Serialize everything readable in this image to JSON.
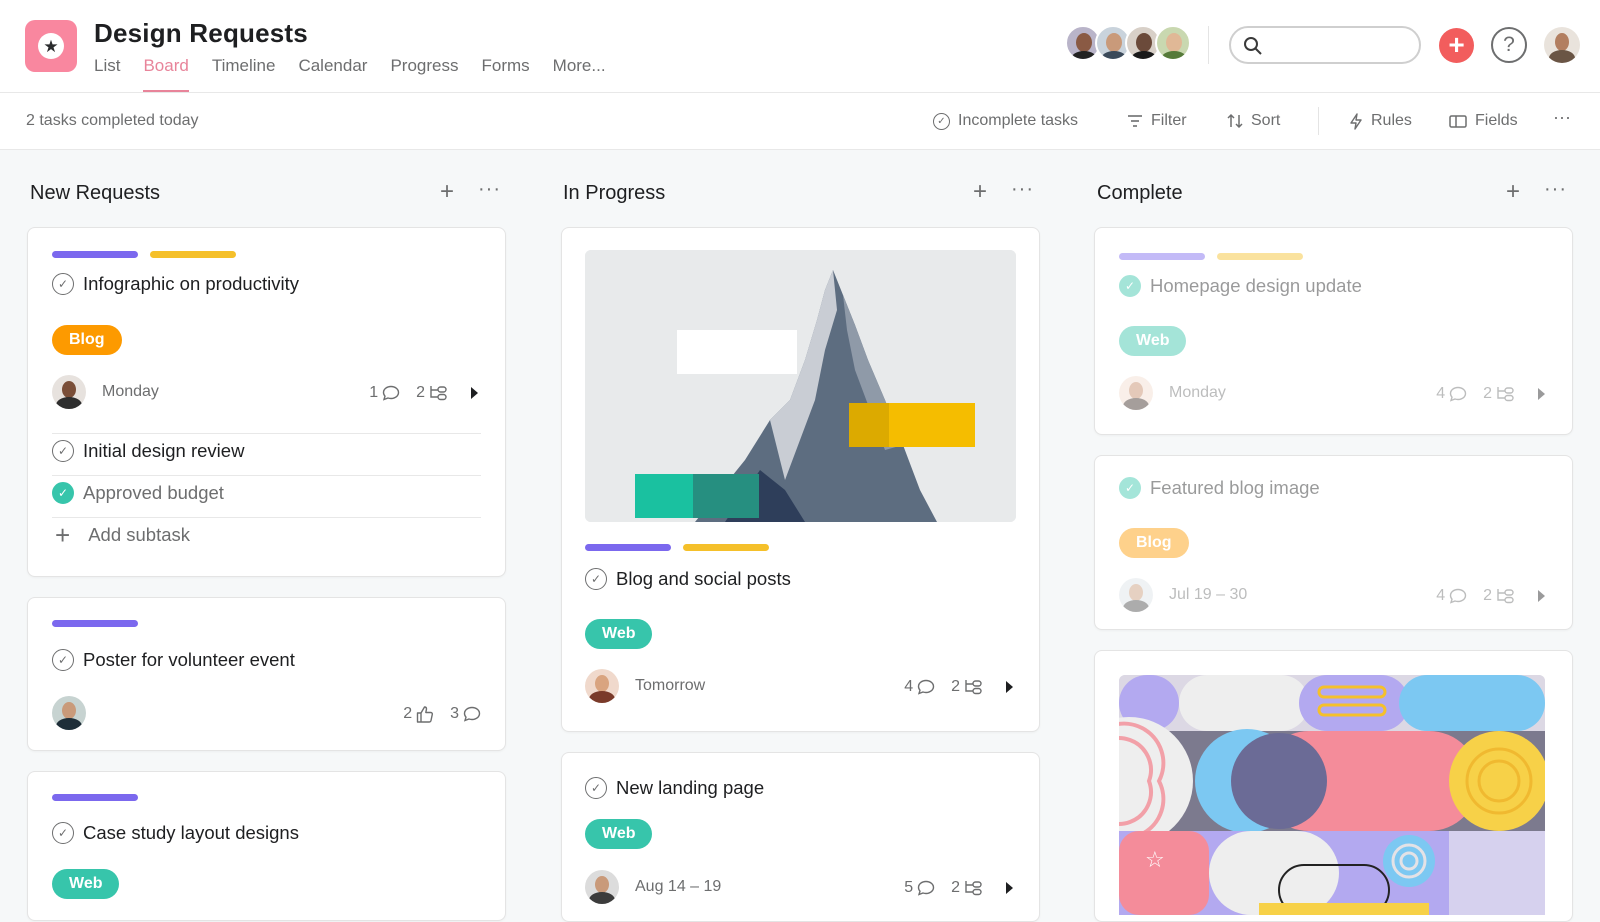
{
  "header": {
    "title": "Design Requests",
    "tabs": [
      "List",
      "Board",
      "Timeline",
      "Calendar",
      "Progress",
      "Forms",
      "More..."
    ],
    "active_tab": "Board",
    "search": {
      "value": "",
      "placeholder": ""
    }
  },
  "toolbar": {
    "completed_text": "2 tasks completed today",
    "incomplete_label": "Incomplete tasks",
    "filter_label": "Filter",
    "sort_label": "Sort",
    "rules_label": "Rules",
    "fields_label": "Fields",
    "more": "···"
  },
  "columns": {
    "new_requests": {
      "title": "New Requests",
      "cards": [
        {
          "title": "Infographic on productivity",
          "tag": "Blog",
          "date": "Monday",
          "comments": "1",
          "subtasks": "2",
          "subtask_items": [
            {
              "label": "Initial design review",
              "done": false
            },
            {
              "label": "Approved budget",
              "done": true
            }
          ],
          "add_subtask": "Add subtask"
        },
        {
          "title": "Poster for volunteer event",
          "likes": "2",
          "comments": "3"
        },
        {
          "title": "Case study layout designs",
          "tag": "Web"
        }
      ]
    },
    "in_progress": {
      "title": "In Progress",
      "cards": [
        {
          "title": "Blog and social posts",
          "tag": "Web",
          "date": "Tomorrow",
          "comments": "4",
          "subtasks": "2"
        },
        {
          "title": "New landing page",
          "tag": "Web",
          "date": "Aug 14 – 19",
          "comments": "5",
          "subtasks": "2"
        }
      ]
    },
    "complete": {
      "title": "Complete",
      "cards": [
        {
          "title": "Homepage design update",
          "tag": "Web",
          "date": "Monday",
          "comments": "4",
          "subtasks": "2"
        },
        {
          "title": "Featured blog image",
          "tag": "Blog",
          "date": "Jul 19 – 30",
          "comments": "4",
          "subtasks": "2"
        }
      ]
    }
  },
  "colors": {
    "accent_pink": "#e8849a",
    "purple": "#7b68ee",
    "yellow": "#f5c02a",
    "orange_blog": "#fd9a00",
    "teal_web": "#37c5ab",
    "red_add": "#f25d5d"
  },
  "icons": [
    "star-icon",
    "search-icon",
    "plus-icon",
    "help-icon",
    "check-circle-icon",
    "filter-icon",
    "sort-icon",
    "bolt-icon",
    "fields-icon",
    "comment-icon",
    "subtask-icon",
    "thumbs-up-icon",
    "caret-right-icon"
  ]
}
